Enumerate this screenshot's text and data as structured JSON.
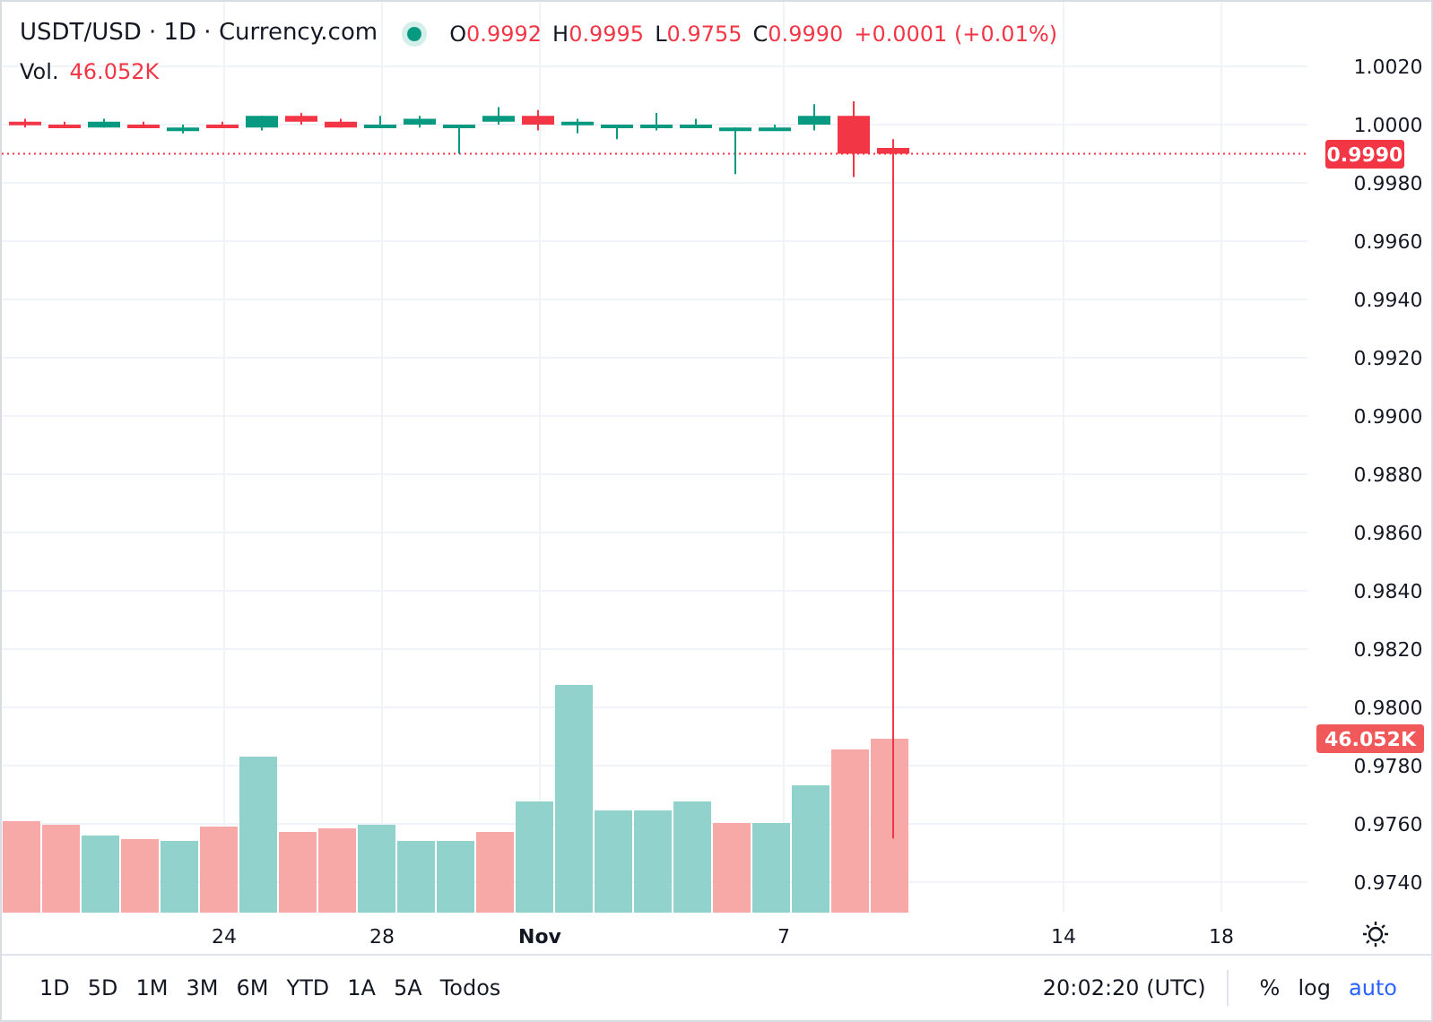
{
  "legend": {
    "symbol": "USDT/USD · 1D · Currency.com",
    "ohlc": [
      {
        "label": "O",
        "value": "0.9992"
      },
      {
        "label": "H",
        "value": "0.9995"
      },
      {
        "label": "L",
        "value": "0.9755"
      },
      {
        "label": "C",
        "value": "0.9990"
      }
    ],
    "change": "+0.0001 (+0.01%)",
    "volume_label": "Vol.",
    "volume_value": "46.052K"
  },
  "price_axis": {
    "ticks": [
      "1.0020",
      "1.0000",
      "0.9980",
      "0.9960",
      "0.9940",
      "0.9920",
      "0.9900",
      "0.9880",
      "0.9860",
      "0.9840",
      "0.9820",
      "0.9800",
      "0.9780",
      "0.9760",
      "0.9740"
    ],
    "last_price": "0.9990",
    "last_volume": "46.052K"
  },
  "time_axis": [
    "24",
    "28",
    "Nov",
    "7",
    "14",
    "18"
  ],
  "toolbar": {
    "ranges": [
      "1D",
      "5D",
      "1M",
      "3M",
      "6M",
      "YTD",
      "1A",
      "5A",
      "Todos"
    ],
    "clock": "20:02:20 (UTC)",
    "options": [
      {
        "label": "%",
        "selected": false
      },
      {
        "label": "log",
        "selected": false
      },
      {
        "label": "auto",
        "selected": true
      }
    ]
  }
}
